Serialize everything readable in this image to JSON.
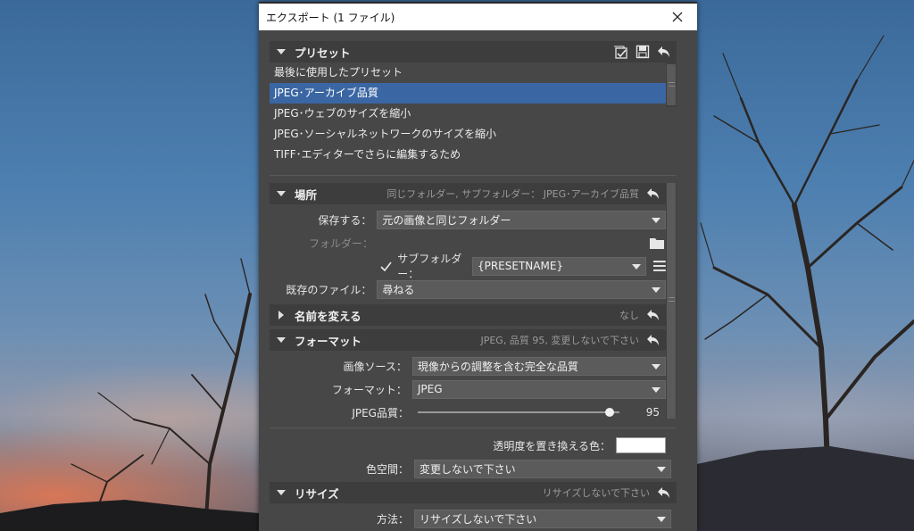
{
  "window": {
    "title": "エクスポート (1 ファイル)"
  },
  "presets": {
    "header": "プリセット",
    "items": [
      {
        "label": "最後に使用したプリセット",
        "selected": false
      },
      {
        "label": "JPEG･アーカイブ品質",
        "selected": true
      },
      {
        "label": "JPEG･ウェブのサイズを縮小",
        "selected": false
      },
      {
        "label": "JPEG･ソーシャルネットワークのサイズを縮小",
        "selected": false
      },
      {
        "label": "TIFF･エディターでさらに編集するため",
        "selected": false
      }
    ]
  },
  "location": {
    "header": "場所",
    "summary": "同じフォルダー, サブフォルダー： JPEG･アーカイブ品質",
    "save_to_label": "保存する：",
    "save_to_value": "元の画像と同じフォルダー",
    "folder_label": "フォルダー：",
    "subfolder_label": "サブフォルダー：",
    "subfolder_checked": true,
    "subfolder_value": "{PRESETNAME}",
    "existing_label": "既存のファイル：",
    "existing_value": "尋ねる"
  },
  "rename": {
    "header": "名前を変える",
    "summary": "なし"
  },
  "format": {
    "header": "フォーマット",
    "summary": "JPEG, 品質 95, 変更しないで下さい",
    "source_label": "画像ソース：",
    "source_value": "現像からの調整を含む完全な品質",
    "format_label": "フォーマット：",
    "format_value": "JPEG",
    "quality_label": "JPEG品質：",
    "quality_value": "95",
    "quality_max": 100,
    "transparency_label": "透明度を置き換える色：",
    "transparency_color": "#ffffff",
    "colorspace_label": "色空間：",
    "colorspace_value": "変更しないで下さい"
  },
  "resize": {
    "header": "リサイズ",
    "summary": "リサイズしないで下さい",
    "method_label": "方法：",
    "method_value": "リサイズしないで下さい"
  },
  "colors": {
    "selection": "#3a66a3",
    "panel": "#474747",
    "header": "#3d3d3d"
  }
}
